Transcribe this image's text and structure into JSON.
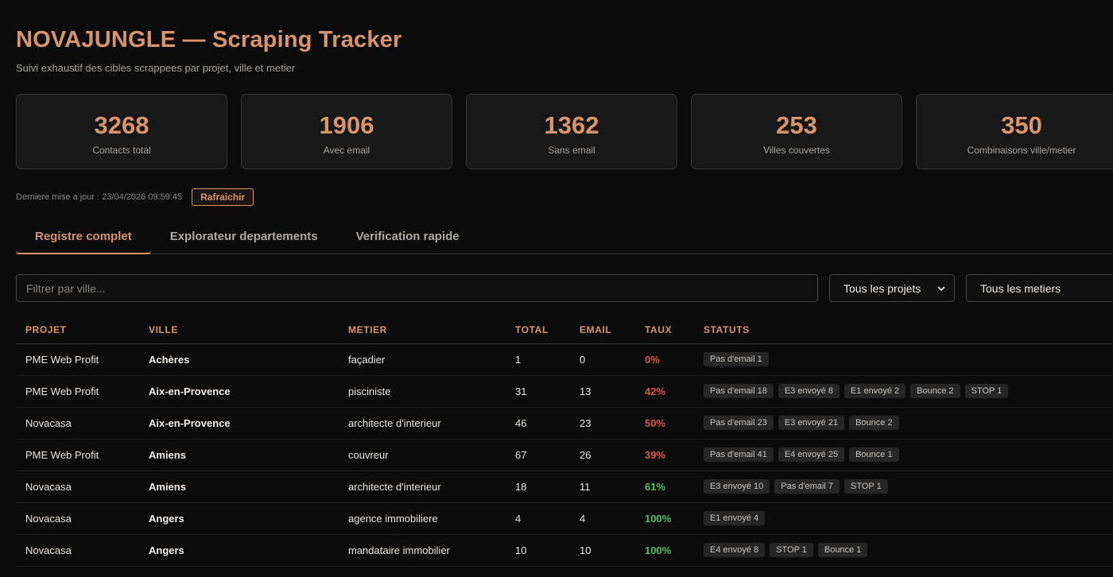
{
  "header": {
    "title": "NOVAJUNGLE — Scraping Tracker",
    "subtitle": "Suivi exhaustif des cibles scrappees par projet, ville et metier"
  },
  "stats": [
    {
      "value": "3268",
      "label": "Contacts total"
    },
    {
      "value": "1906",
      "label": "Avec email"
    },
    {
      "value": "1362",
      "label": "Sans email"
    },
    {
      "value": "253",
      "label": "Villes couvertes"
    },
    {
      "value": "350",
      "label": "Combinaisons ville/metier"
    }
  ],
  "update": {
    "text": "Derniere mise a jour : 23/04/2026 09:59:45",
    "refresh_label": "Rafraichir"
  },
  "tabs": [
    {
      "label": "Registre complet",
      "active": true
    },
    {
      "label": "Explorateur departements",
      "active": false
    },
    {
      "label": "Verification rapide",
      "active": false
    }
  ],
  "filters": {
    "ville_placeholder": "Filtrer par ville...",
    "projet_selected": "Tous les projets",
    "metier_selected": "Tous les metiers"
  },
  "table": {
    "columns": [
      "PROJET",
      "VILLE",
      "METIER",
      "TOTAL",
      "EMAIL",
      "TAUX",
      "STATUTS"
    ],
    "rows": [
      {
        "projet": "PME Web Profit",
        "ville": "Achères",
        "metier": "façadier",
        "total": "1",
        "email": "0",
        "taux": "0%",
        "level": "low",
        "statuts": [
          "Pas d'email 1"
        ]
      },
      {
        "projet": "PME Web Profit",
        "ville": "Aix-en-Provence",
        "metier": "pisciniste",
        "total": "31",
        "email": "13",
        "taux": "42%",
        "level": "low",
        "statuts": [
          "Pas d'email 18",
          "E3 envoyé 8",
          "E1 envoyé 2",
          "Bounce 2",
          "STOP 1"
        ]
      },
      {
        "projet": "Novacasa",
        "ville": "Aix-en-Provence",
        "metier": "architecte d'interieur",
        "total": "46",
        "email": "23",
        "taux": "50%",
        "level": "low",
        "statuts": [
          "Pas d'email 23",
          "E3 envoyé 21",
          "Bounce 2"
        ]
      },
      {
        "projet": "PME Web Profit",
        "ville": "Amiens",
        "metier": "couvreur",
        "total": "67",
        "email": "26",
        "taux": "39%",
        "level": "low",
        "statuts": [
          "Pas d'email 41",
          "E4 envoyé 25",
          "Bounce 1"
        ]
      },
      {
        "projet": "Novacasa",
        "ville": "Amiens",
        "metier": "architecte d'interieur",
        "total": "18",
        "email": "11",
        "taux": "61%",
        "level": "high",
        "statuts": [
          "E3 envoyé 10",
          "Pas d'email 7",
          "STOP 1"
        ]
      },
      {
        "projet": "Novacasa",
        "ville": "Angers",
        "metier": "agence immobiliere",
        "total": "4",
        "email": "4",
        "taux": "100%",
        "level": "high",
        "statuts": [
          "E1 envoyé 4"
        ]
      },
      {
        "projet": "Novacasa",
        "ville": "Angers",
        "metier": "mandataire immobilier",
        "total": "10",
        "email": "10",
        "taux": "100%",
        "level": "high",
        "statuts": [
          "E4 envoyé 8",
          "STOP 1",
          "Bounce 1"
        ]
      }
    ]
  },
  "colors": {
    "accent": "#d9956a",
    "low": "#e0524a",
    "high": "#4fbe6a"
  }
}
